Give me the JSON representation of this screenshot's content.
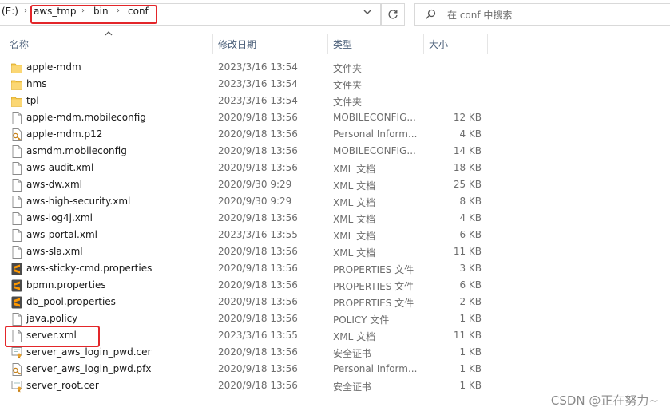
{
  "address": {
    "drive": "(E:)",
    "crumbs": [
      "aws_tmp",
      "bin",
      "conf"
    ]
  },
  "search": {
    "placeholder": "在 conf 中搜索"
  },
  "columns": {
    "name": "名称",
    "date": "修改日期",
    "type": "类型",
    "size": "大小"
  },
  "files": [
    {
      "name": "apple-mdm",
      "date": "2023/3/16 13:54",
      "type": "文件夹",
      "size": "",
      "icon": "folder-icon"
    },
    {
      "name": "hms",
      "date": "2023/3/16 13:54",
      "type": "文件夹",
      "size": "",
      "icon": "folder-icon"
    },
    {
      "name": "tpl",
      "date": "2023/3/16 13:54",
      "type": "文件夹",
      "size": "",
      "icon": "folder-icon"
    },
    {
      "name": "apple-mdm.mobileconfig",
      "date": "2020/9/18 13:56",
      "type": "MOBILECONFIG...",
      "size": "12 KB",
      "icon": "file-icon"
    },
    {
      "name": "apple-mdm.p12",
      "date": "2020/9/18 13:56",
      "type": "Personal Inform...",
      "size": "4 KB",
      "icon": "certificate-key-icon"
    },
    {
      "name": "asmdm.mobileconfig",
      "date": "2020/9/18 13:56",
      "type": "MOBILECONFIG...",
      "size": "14 KB",
      "icon": "file-icon"
    },
    {
      "name": "aws-audit.xml",
      "date": "2020/9/18 13:56",
      "type": "XML 文档",
      "size": "18 KB",
      "icon": "file-icon"
    },
    {
      "name": "aws-dw.xml",
      "date": "2020/9/30 9:29",
      "type": "XML 文档",
      "size": "25 KB",
      "icon": "file-icon"
    },
    {
      "name": "aws-high-security.xml",
      "date": "2020/9/30 9:29",
      "type": "XML 文档",
      "size": "8 KB",
      "icon": "file-icon"
    },
    {
      "name": "aws-log4j.xml",
      "date": "2020/9/18 13:56",
      "type": "XML 文档",
      "size": "4 KB",
      "icon": "file-icon"
    },
    {
      "name": "aws-portal.xml",
      "date": "2023/3/16 13:55",
      "type": "XML 文档",
      "size": "6 KB",
      "icon": "file-icon"
    },
    {
      "name": "aws-sla.xml",
      "date": "2020/9/18 13:56",
      "type": "XML 文档",
      "size": "11 KB",
      "icon": "file-icon"
    },
    {
      "name": "aws-sticky-cmd.properties",
      "date": "2020/9/18 13:56",
      "type": "PROPERTIES 文件",
      "size": "3 KB",
      "icon": "sublime-icon"
    },
    {
      "name": "bpmn.properties",
      "date": "2020/9/18 13:56",
      "type": "PROPERTIES 文件",
      "size": "6 KB",
      "icon": "sublime-icon"
    },
    {
      "name": "db_pool.properties",
      "date": "2020/9/18 13:56",
      "type": "PROPERTIES 文件",
      "size": "2 KB",
      "icon": "sublime-icon"
    },
    {
      "name": "java.policy",
      "date": "2020/9/18 13:56",
      "type": "POLICY 文件",
      "size": "1 KB",
      "icon": "file-icon"
    },
    {
      "name": "server.xml",
      "date": "2023/3/16 13:55",
      "type": "XML 文档",
      "size": "11 KB",
      "icon": "file-icon"
    },
    {
      "name": "server_aws_login_pwd.cer",
      "date": "2020/9/18 13:56",
      "type": "安全证书",
      "size": "1 KB",
      "icon": "certificate-icon"
    },
    {
      "name": "server_aws_login_pwd.pfx",
      "date": "2020/9/18 13:56",
      "type": "Personal Inform...",
      "size": "1 KB",
      "icon": "certificate-key-icon"
    },
    {
      "name": "server_root.cer",
      "date": "2020/9/18 13:56",
      "type": "安全证书",
      "size": "1 KB",
      "icon": "certificate-icon"
    }
  ],
  "watermark": "CSDN @正在努力~",
  "colors": {
    "highlight": "#e3262a",
    "header_text": "#4c607a",
    "folder": "#f6c84b"
  }
}
